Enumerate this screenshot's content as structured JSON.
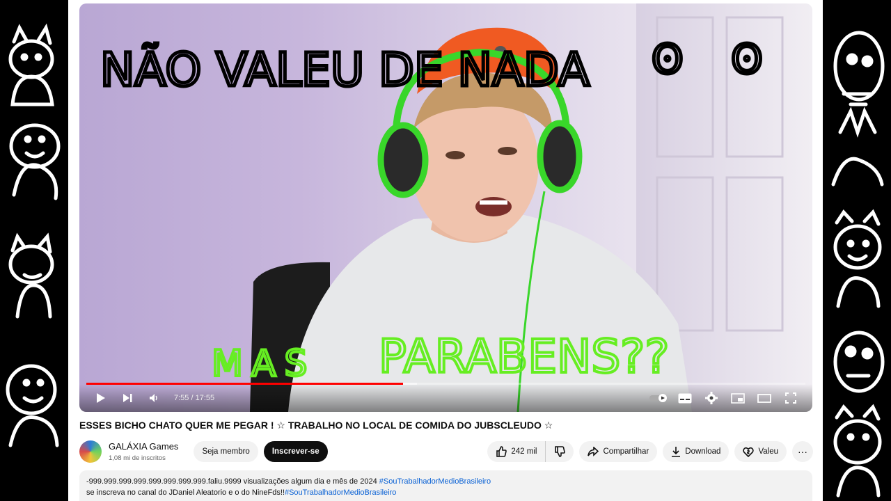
{
  "overlay_text": {
    "top": "NÃO VALEU DE NADA",
    "top_faces": "ʘ ʘ",
    "bottom_left": "MAS",
    "bottom_right": "PARABENS??"
  },
  "player": {
    "current_time": "7:55",
    "separator": " / ",
    "duration": "17:55",
    "progress": 0.44,
    "colors": {
      "progress": "#ff0000",
      "overlay_black": "#000000",
      "overlay_green": "#66ee22"
    }
  },
  "video": {
    "title": "ESSES BICHO CHATO QUER ME PEGAR ! ☆ TRABALHO NO LOCAL DE COMIDA DO JUBSCLEUDO ☆"
  },
  "channel": {
    "name": "GALÁXIA Games",
    "subscribers": "1,08 mi de inscritos",
    "member_button": "Seja membro",
    "subscribe_button": "Inscrever-se"
  },
  "actions": {
    "likes": "242 mil",
    "share": "Compartilhar",
    "download": "Download",
    "thanks": "Valeu",
    "more": "···"
  },
  "description": {
    "line1": "-999.999.999.999.999.999.999.999.faliu.9999 visualizações  algum dia e mês de 2024",
    "line1_tag": "#SouTrabalhadorMedioBrasileiro",
    "line2": "se inscreva no canal do JDaniel Aleatorio e o do NineFds!!",
    "line2_tag": "#SouTrabalhadorMedioBrasileiro"
  }
}
